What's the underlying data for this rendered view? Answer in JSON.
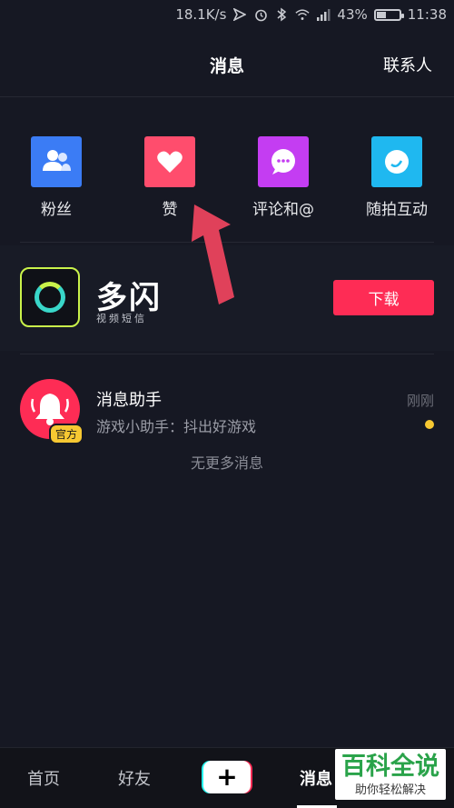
{
  "status": {
    "speed": "18.1K/s",
    "battery": "43%",
    "battery_level": 0.43,
    "time": "11:38"
  },
  "header": {
    "title": "消息",
    "contacts": "联系人"
  },
  "categories": [
    {
      "label": "粉丝",
      "icon": "fans-icon",
      "color": "#3b7cf5"
    },
    {
      "label": "赞",
      "icon": "heart-icon",
      "color": "#ff4d6d"
    },
    {
      "label": "评论和@",
      "icon": "comment-icon",
      "color": "#c43df2"
    },
    {
      "label": "随拍互动",
      "icon": "camera-icon",
      "color": "#1fb8f0"
    }
  ],
  "ad": {
    "name": "多闪",
    "tagline": "视频短信",
    "button": "下载"
  },
  "messages": [
    {
      "title": "消息助手",
      "subtitle": "游戏小助手：抖出好游戏",
      "time": "刚刚",
      "badge": "官方"
    }
  ],
  "no_more": "无更多消息",
  "tabs": [
    {
      "label": "首页",
      "active": false
    },
    {
      "label": "好友",
      "active": false
    },
    {
      "label": "+",
      "active": false
    },
    {
      "label": "消息",
      "active": true
    }
  ],
  "watermark": {
    "title": "百科全说",
    "subtitle": "助你轻松解决"
  },
  "colors": {
    "accent": "#fe2c55",
    "background": "#161823",
    "unread_dot": "#f7c832"
  }
}
